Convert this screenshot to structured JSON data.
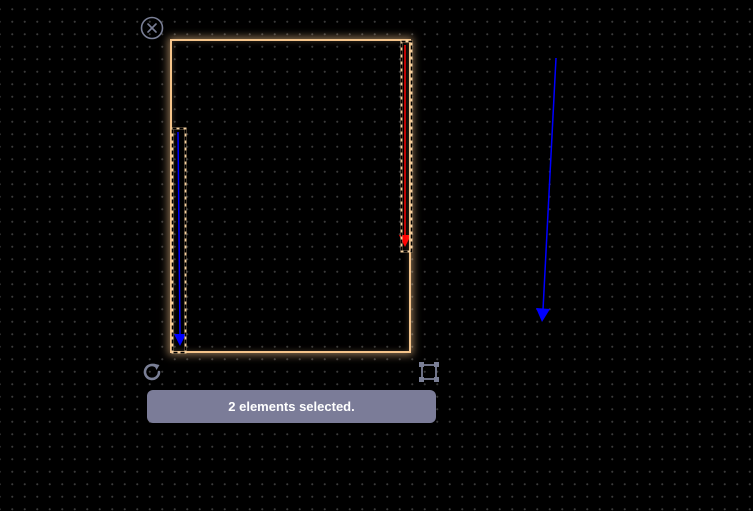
{
  "canvas": {
    "background_color": "#000000",
    "grid_dot_color": "#3a3a3a"
  },
  "selection": {
    "status_text": "2 elements selected.",
    "frame_color": "#f5c48a",
    "close_icon": "close-circle-icon",
    "rotate_icon": "rotate-icon",
    "resize_icon": "resize-frame-icon"
  },
  "arrows": [
    {
      "name": "red-arrow",
      "color": "#ff0000",
      "selected": true
    },
    {
      "name": "blue-arrow-selected",
      "color": "#0000ff",
      "selected": true
    },
    {
      "name": "blue-arrow",
      "color": "#0000ff",
      "selected": false
    }
  ],
  "colors": {
    "status_background": "#7b7c98",
    "icon_color": "#7a7f96"
  }
}
